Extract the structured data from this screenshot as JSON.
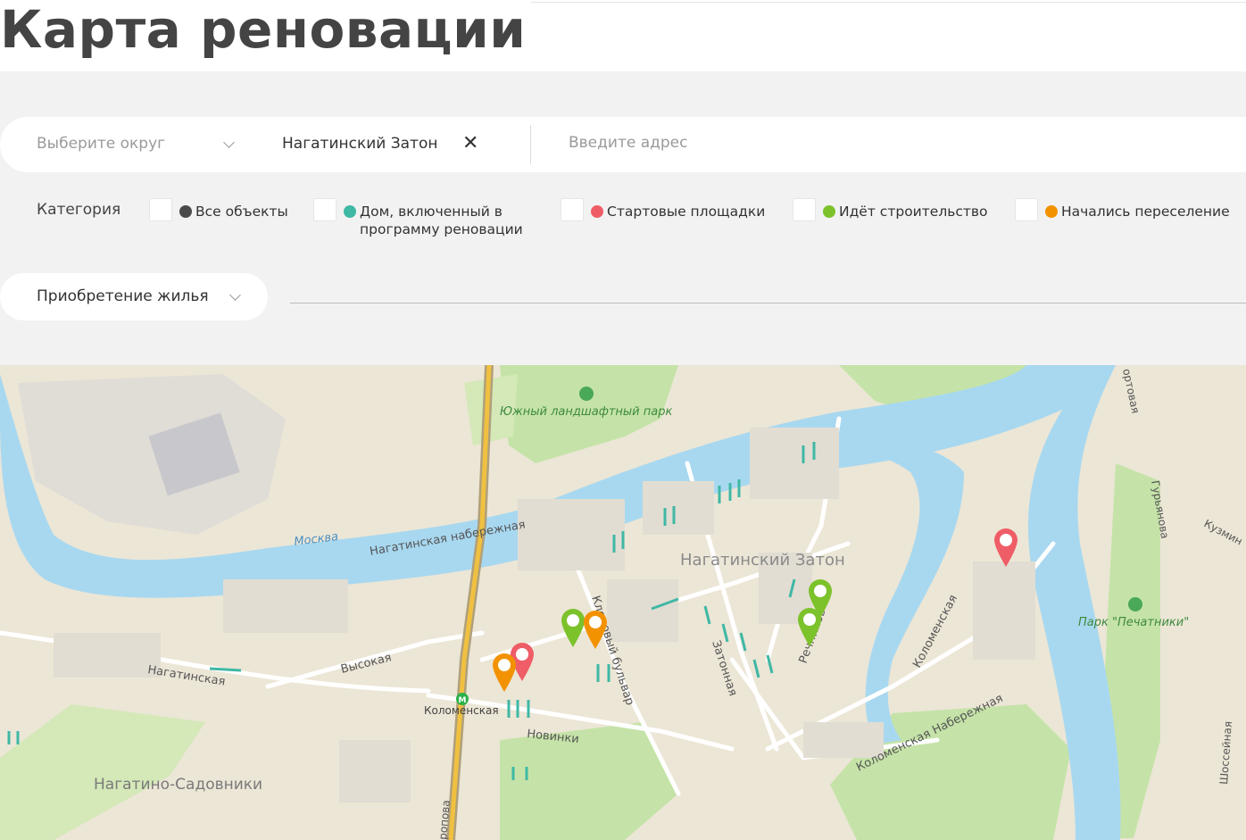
{
  "header": {
    "title": "Карта реновации"
  },
  "filters": {
    "district_placeholder": "Выберите округ",
    "area_value": "Нагатинский Затон",
    "clear_label": "✕",
    "address_placeholder": "Введите адрес",
    "category_label": "Категория",
    "categories": [
      {
        "label": "Все объекты",
        "color": "#4a4a4a"
      },
      {
        "label": "Дом, включенный в программу реновации",
        "color": "#3fb8a5"
      },
      {
        "label": "Стартовые площадки",
        "color": "#ef5d67"
      },
      {
        "label": "Идёт строительство",
        "color": "#7cc22b"
      },
      {
        "label": "Начались переселение",
        "color": "#f39200"
      }
    ],
    "acquisition_label": "Приобретение жилья"
  },
  "map": {
    "labels": {
      "district_center": "Нагатинский Затон",
      "district_sw": "Нагатино-Садовники",
      "river": "Москва",
      "park_south": "Южный ландшафтный парк",
      "park_pechatniki": "Парк \"Печатники\"",
      "quay_nagatinskaya": "Нагатинская набережная",
      "quay_kolomenskaya": "Коломенская Набережная",
      "street_klenovy": "Кленовый бульвар",
      "street_zatonnaya": "Затонная",
      "street_rechnikov": "Речников",
      "street_kolomenskaya": "Коломенская",
      "street_vysokaya": "Высокая",
      "street_nagatinskaya": "Нагатинская",
      "street_novinki": "Новинки",
      "street_guryanova": "Гурьянова",
      "street_shosseynaya": "Шоссейная",
      "street_kuzminskaya": "Кузмин",
      "street_portovaya": "ортовая",
      "street_bottom": "ропова",
      "metro_kolomenskaya": "Коломенская"
    },
    "markers": [
      {
        "category": "start",
        "color": "#ef5d67"
      },
      {
        "category": "start",
        "color": "#ef5d67"
      },
      {
        "category": "construction",
        "color": "#7cc22b"
      },
      {
        "category": "construction",
        "color": "#7cc22b"
      },
      {
        "category": "construction",
        "color": "#7cc22b"
      },
      {
        "category": "resettlement",
        "color": "#f39200"
      },
      {
        "category": "resettlement",
        "color": "#f39200"
      }
    ],
    "metro_color": "#2bb24a",
    "water_color": "#a8d8f0",
    "park_color": "#c5e3a8"
  }
}
